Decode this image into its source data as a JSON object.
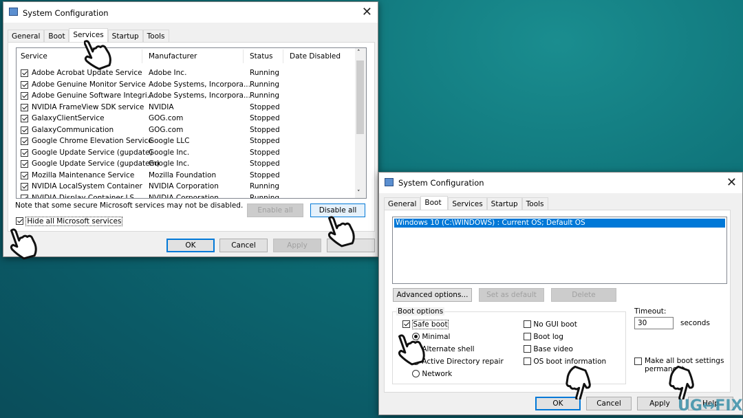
{
  "services_dialog": {
    "title": "System Configuration",
    "tabs": [
      "General",
      "Boot",
      "Services",
      "Startup",
      "Tools"
    ],
    "active_tab": "Services",
    "columns": [
      "Service",
      "Manufacturer",
      "Status",
      "Date Disabled"
    ],
    "rows": [
      {
        "checked": true,
        "service": "Adobe Acrobat Update Service",
        "manufacturer": "Adobe Inc.",
        "status": "Running"
      },
      {
        "checked": true,
        "service": "Adobe Genuine Monitor Service",
        "manufacturer": "Adobe Systems, Incorpora...",
        "status": "Running"
      },
      {
        "checked": true,
        "service": "Adobe Genuine Software Integri...",
        "manufacturer": "Adobe Systems, Incorpora...",
        "status": "Running"
      },
      {
        "checked": true,
        "service": "NVIDIA FrameView SDK service",
        "manufacturer": "NVIDIA",
        "status": "Stopped"
      },
      {
        "checked": true,
        "service": "GalaxyClientService",
        "manufacturer": "GOG.com",
        "status": "Stopped"
      },
      {
        "checked": true,
        "service": "GalaxyCommunication",
        "manufacturer": "GOG.com",
        "status": "Stopped"
      },
      {
        "checked": true,
        "service": "Google Chrome Elevation Service",
        "manufacturer": "Google LLC",
        "status": "Stopped"
      },
      {
        "checked": true,
        "service": "Google Update Service (gupdate)",
        "manufacturer": "Google Inc.",
        "status": "Stopped"
      },
      {
        "checked": true,
        "service": "Google Update Service (gupdatem)",
        "manufacturer": "Google Inc.",
        "status": "Stopped"
      },
      {
        "checked": true,
        "service": "Mozilla Maintenance Service",
        "manufacturer": "Mozilla Foundation",
        "status": "Stopped"
      },
      {
        "checked": true,
        "service": "NVIDIA LocalSystem Container",
        "manufacturer": "NVIDIA Corporation",
        "status": "Running"
      },
      {
        "checked": true,
        "service": "NVIDIA Display Container LS",
        "manufacturer": "NVIDIA Corporation",
        "status": "Running"
      }
    ],
    "note": "Note that some secure Microsoft services may not be disabled.",
    "enable_all": "Enable all",
    "disable_all": "Disable all",
    "hide_ms": "Hide all Microsoft services",
    "hide_ms_checked": true,
    "ok": "OK",
    "cancel": "Cancel",
    "apply": "Apply"
  },
  "boot_dialog": {
    "title": "System Configuration",
    "tabs": [
      "General",
      "Boot",
      "Services",
      "Startup",
      "Tools"
    ],
    "active_tab": "Boot",
    "os_entry": "Windows 10 (C:\\WINDOWS) : Current OS; Default OS",
    "advanced": "Advanced options...",
    "set_default": "Set as default",
    "delete": "Delete",
    "boot_options_label": "Boot options",
    "safe_boot": "Safe boot",
    "safe_boot_checked": true,
    "minimal": "Minimal",
    "alternate_shell": "Alternate shell",
    "ad_repair": "Active Directory repair",
    "network": "Network",
    "selected_mode": "Minimal",
    "no_gui": "No GUI boot",
    "boot_log": "Boot log",
    "base_video": "Base video",
    "os_boot_info": "OS boot information",
    "timeout_label": "Timeout:",
    "timeout_value": "30",
    "seconds": "seconds",
    "make_permanent": "Make all boot settings permanent",
    "ok": "OK",
    "cancel": "Cancel",
    "apply": "Apply",
    "help": "Help"
  },
  "watermark": "UG↔FIX",
  "colors": {
    "selection": "#0078d7",
    "background": "#0d6f76"
  }
}
